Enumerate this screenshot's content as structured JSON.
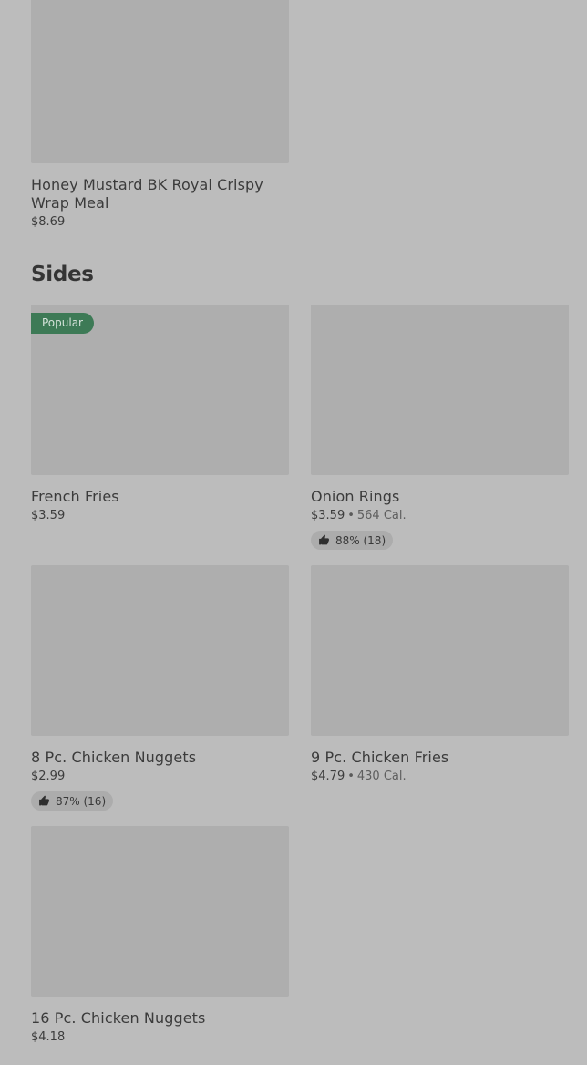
{
  "top_item": {
    "name": "Honey Mustard BK Royal Crispy Wrap Meal",
    "price": "$8.69"
  },
  "section": {
    "title": "Sides"
  },
  "items": [
    {
      "name": "French Fries",
      "price": "$3.59",
      "badge": "Popular"
    },
    {
      "name": "Onion Rings",
      "price": "$3.59",
      "separator": "•",
      "calories": "564 Cal.",
      "rating": "88% (18)",
      "rating_icon": "thumbs-up-icon"
    },
    {
      "name": "8 Pc. Chicken Nuggets",
      "price": "$2.99",
      "rating": "87% (16)",
      "rating_icon": "thumbs-up-icon"
    },
    {
      "name": "9 Pc. Chicken Fries",
      "price": "$4.79",
      "separator": "•",
      "calories": "430 Cal."
    },
    {
      "name": "16 Pc. Chicken Nuggets",
      "price": "$4.18"
    }
  ],
  "colors": {
    "background": "#bcbcbc",
    "image_placeholder": "#aeaeae",
    "badge": "#3d7a56",
    "rating_pill": "#acacac"
  }
}
